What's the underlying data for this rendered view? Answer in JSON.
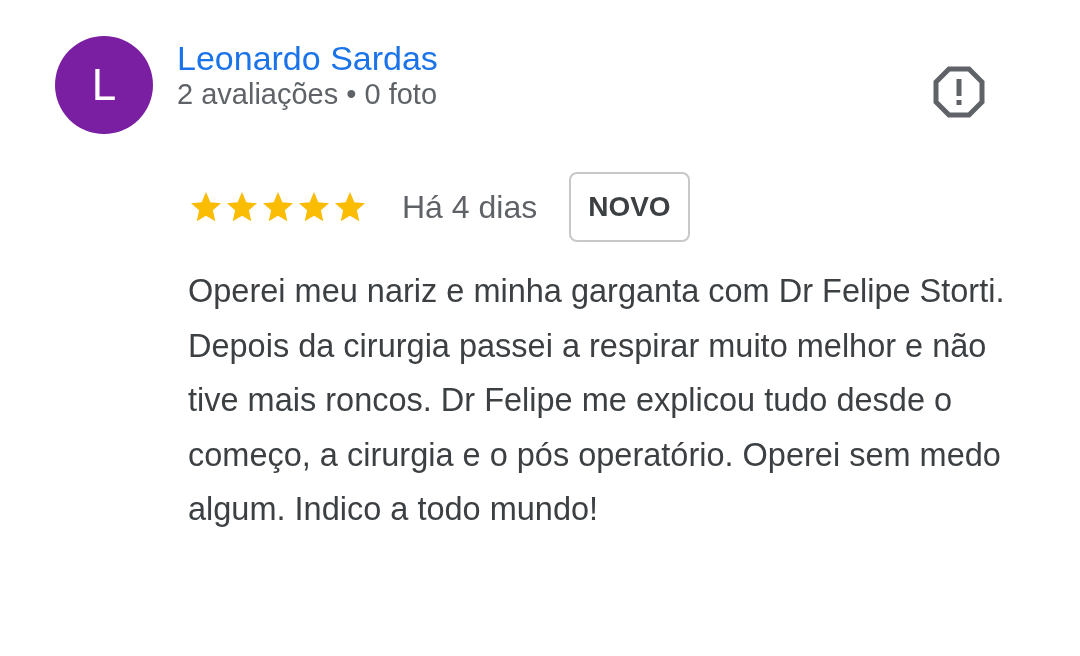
{
  "review": {
    "avatar_letter": "L",
    "author": "Leonardo Sardas",
    "author_stats": "2 avaliações • 0 foto",
    "stars": 5,
    "time": "Há 4 dias",
    "badge": "NOVO",
    "text": "Operei meu nariz e minha garganta com Dr Felipe Storti. Depois da cirurgia passei a respirar muito melhor e não tive mais roncos. Dr Felipe me explicou tudo desde o começo, a cirurgia e o pós operatório. Operei sem medo algum. Indico a todo mundo!"
  }
}
